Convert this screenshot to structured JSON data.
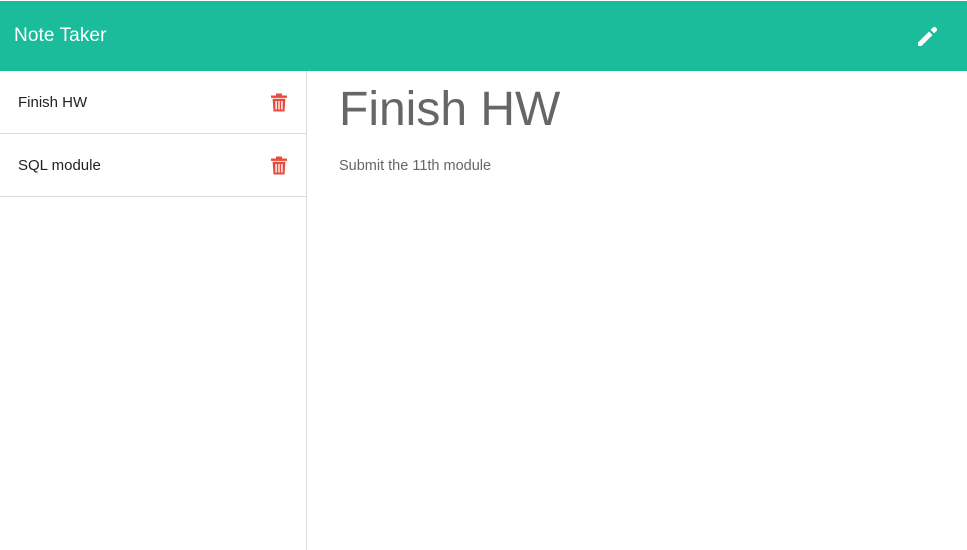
{
  "app": {
    "title": "Note Taker",
    "accent_color": "#1abc9c",
    "delete_color": "#e74c3c",
    "new_note_icon": "pencil-icon",
    "delete_icon": "trash-icon"
  },
  "notes": [
    {
      "title": "Finish HW"
    },
    {
      "title": "SQL module"
    }
  ],
  "active_note": {
    "title": "Finish HW",
    "text": "Submit the 11th module"
  }
}
